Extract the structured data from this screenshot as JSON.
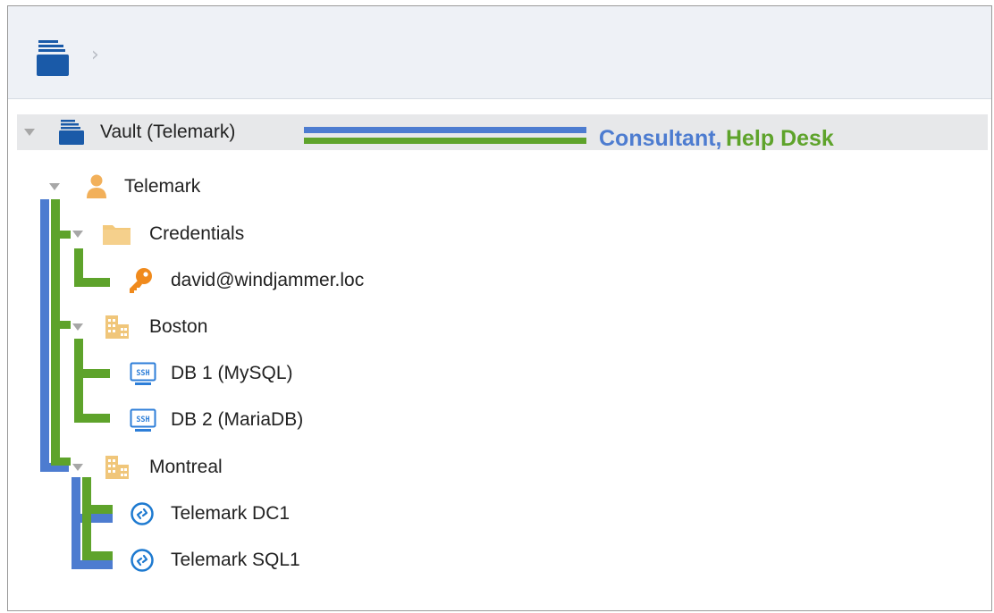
{
  "colors": {
    "blue": "#4d7cd0",
    "green": "#5ea32b",
    "folder_dark_blue": "#1a5aa8",
    "user_orange": "#f2b05a",
    "key_orange": "#f08a1c",
    "folder_tan": "#f3c97c",
    "building_tan": "#f0c67a",
    "ssh_blue": "#2d7ed8",
    "rdp_blue": "#1e7ad0"
  },
  "breadcrumb": {
    "icon": "vault-icon",
    "separator": "›"
  },
  "tree": {
    "root": {
      "label": "Vault (Telemark)",
      "icon": "vault-icon"
    },
    "permissions": {
      "blue_label": "Consultant,",
      "green_label": "Help Desk"
    },
    "telemark": {
      "label": "Telemark",
      "icon": "user-icon"
    },
    "credentials": {
      "label": "Credentials",
      "icon": "folder-icon"
    },
    "credential_item": {
      "label": "david@windjammer.loc",
      "icon": "key-icon"
    },
    "boston": {
      "label": "Boston",
      "icon": "building-icon"
    },
    "db1": {
      "label": "DB 1 (MySQL)",
      "icon": "ssh-icon"
    },
    "db2": {
      "label": "DB 2 (MariaDB)",
      "icon": "ssh-icon"
    },
    "montreal": {
      "label": "Montreal",
      "icon": "building-icon"
    },
    "dc1": {
      "label": "Telemark DC1",
      "icon": "rdp-icon"
    },
    "sql1": {
      "label": "Telemark SQL1",
      "icon": "rdp-icon"
    },
    "ssh_badge_text": "SSH"
  }
}
